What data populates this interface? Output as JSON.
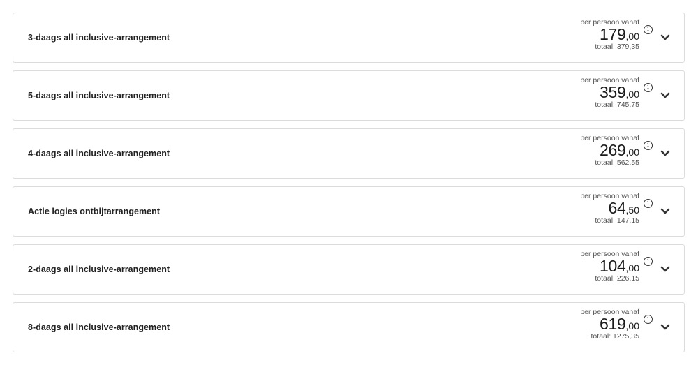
{
  "offers": [
    {
      "title": "3-daags all inclusive-arrangement",
      "per_person_label": "per persoon vanaf",
      "price_int": "179",
      "price_dec": ",00",
      "total": "totaal: 379,35",
      "info_icon": "info-icon",
      "toggle_icon": "chevron-down-icon"
    },
    {
      "title": "5-daags all inclusive-arrangement",
      "per_person_label": "per persoon vanaf",
      "price_int": "359",
      "price_dec": ",00",
      "total": "totaal: 745,75",
      "info_icon": "info-icon",
      "toggle_icon": "chevron-down-icon"
    },
    {
      "title": "4-daags all inclusive-arrangement",
      "per_person_label": "per persoon vanaf",
      "price_int": "269",
      "price_dec": ",00",
      "total": "totaal: 562,55",
      "info_icon": "info-icon",
      "toggle_icon": "chevron-down-icon"
    },
    {
      "title": "Actie logies ontbijtarrangement",
      "per_person_label": "per persoon vanaf",
      "price_int": "64",
      "price_dec": ",50",
      "total": "totaal: 147,15",
      "info_icon": "info-icon",
      "toggle_icon": "chevron-down-icon"
    },
    {
      "title": "2-daags all inclusive-arrangement",
      "per_person_label": "per persoon vanaf",
      "price_int": "104",
      "price_dec": ",00",
      "total": "totaal: 226,15",
      "info_icon": "info-icon",
      "toggle_icon": "chevron-down-icon"
    },
    {
      "title": "8-daags all inclusive-arrangement",
      "per_person_label": "per persoon vanaf",
      "price_int": "619",
      "price_dec": ",00",
      "total": "totaal: 1275,35",
      "info_icon": "info-icon",
      "toggle_icon": "chevron-down-icon"
    }
  ],
  "info_glyph": "i",
  "colors": {
    "text": "#1c1c1c",
    "muted": "#555555",
    "border": "#dcdcdc",
    "background": "#ffffff"
  }
}
